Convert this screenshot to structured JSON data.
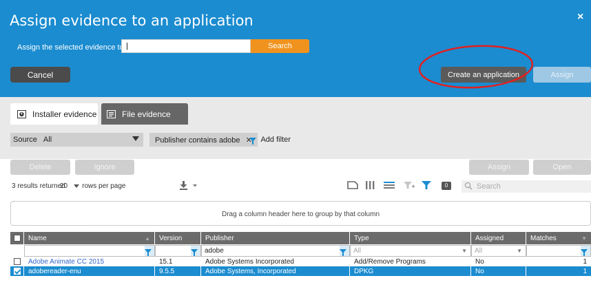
{
  "dialog": {
    "title": "Assign evidence to an application",
    "close_label": "×",
    "assign_label": "Assign the selected evidence to:",
    "assign_input_value": "|",
    "search_label": "Search",
    "cancel_label": "Cancel",
    "create_label": "Create an application",
    "assign_label_btn": "Assign"
  },
  "tabs": [
    {
      "label": "Installer evidence",
      "icon": "installer-icon",
      "active": true
    },
    {
      "label": "File evidence",
      "icon": "file-icon",
      "active": false
    }
  ],
  "filters": {
    "source_label": "Source",
    "source_value": "All",
    "chip_label": "Publisher contains adobe",
    "chip_remove": "✕",
    "add_filter_label": "Add filter"
  },
  "actions": {
    "delete": "Delete",
    "ignore": "Ignore",
    "assign": "Assign",
    "open": "Open"
  },
  "toolbar": {
    "results_text": "3 results returned",
    "rows_value": "20",
    "rows_label": "rows per page",
    "badge_count": "0",
    "search_placeholder": "Search"
  },
  "group_hint": "Drag a column header here to group by that column",
  "table": {
    "columns": [
      "Name",
      "Version",
      "Publisher",
      "Type",
      "Assigned",
      "Matches"
    ],
    "filters": {
      "name": "",
      "version": "",
      "publisher": "adobe",
      "type": "All",
      "assigned": "All",
      "matches": ""
    },
    "rows": [
      {
        "name": "Adobe Animate CC 2015",
        "version": "15.1",
        "publisher": "Adobe Systems Incorporated",
        "type": "Add/Remove Programs",
        "assigned": "No",
        "matches": "1",
        "selected": false
      },
      {
        "name": "adobereader-enu",
        "version": "9.5.5",
        "publisher": "Adobe Systems, Incorporated",
        "type": "DPKG",
        "assigned": "No",
        "matches": "1",
        "selected": true
      }
    ]
  },
  "colors": {
    "header_blue": "#1b8cd0",
    "accent_orange": "#f0931e",
    "annotation_red": "#e02020"
  }
}
